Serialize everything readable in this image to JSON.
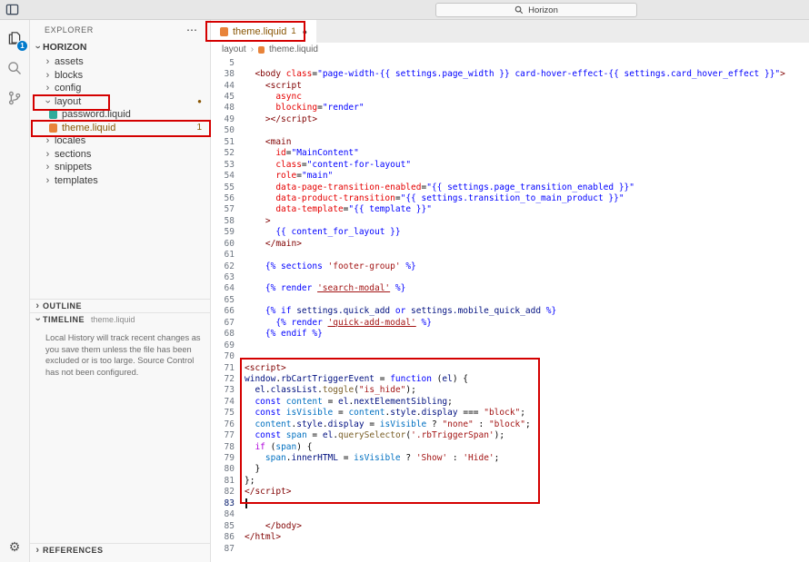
{
  "colors": {
    "annotation_red": "#d40000",
    "badge_blue": "#007acc",
    "git_modified_brown": "#895503",
    "file_icon_orange": "#e8833a",
    "file_icon_teal": "#2fab9b"
  },
  "icons": {
    "chevron": "›",
    "more_actions": "⋯",
    "settings_gear": "⚙",
    "modified_dot": "●"
  },
  "title_bar": {
    "search_text": "Horizon"
  },
  "activity_bar": {
    "badge": "1"
  },
  "sidebar": {
    "header": "EXPLORER",
    "section": "HORIZON",
    "tree": [
      {
        "label": "assets",
        "kind": "folder",
        "expanded": false
      },
      {
        "label": "blocks",
        "kind": "folder",
        "expanded": false
      },
      {
        "label": "config",
        "kind": "folder",
        "expanded": false
      },
      {
        "label": "layout",
        "kind": "folder",
        "expanded": true,
        "dot": true
      },
      {
        "label": "password.liquid",
        "kind": "file",
        "icon": "teal"
      },
      {
        "label": "theme.liquid",
        "kind": "file",
        "icon": "orange",
        "badge": "1",
        "modified": true
      },
      {
        "label": "locales",
        "kind": "folder",
        "expanded": false
      },
      {
        "label": "sections",
        "kind": "folder",
        "expanded": false
      },
      {
        "label": "snippets",
        "kind": "folder",
        "expanded": false
      },
      {
        "label": "templates",
        "kind": "folder",
        "expanded": false
      }
    ],
    "outline": {
      "label": "OUTLINE"
    },
    "timeline": {
      "label": "TIMELINE",
      "file": "theme.liquid",
      "message": "Local History will track recent changes as you save them unless the file has been excluded or is too large. Source Control has not been configured."
    },
    "references": {
      "label": "REFERENCES"
    }
  },
  "editor": {
    "tab": {
      "label": "theme.liquid",
      "badge": "1"
    },
    "breadcrumb": [
      "layout",
      "theme.liquid"
    ],
    "lines": [
      {
        "n": "5",
        "t": []
      },
      {
        "n": "38",
        "t": [
          [
            "tag",
            "  <body "
          ],
          [
            "attr",
            "class"
          ],
          [
            "p",
            "="
          ],
          [
            "str",
            "\"page-width-{{ settings.page_width }} card-hover-effect-{{ settings.card_hover_effect }}\""
          ],
          [
            "tag",
            ">"
          ]
        ]
      },
      {
        "n": "44",
        "t": [
          [
            "tag",
            "    <script"
          ]
        ]
      },
      {
        "n": "45",
        "t": [
          [
            "attr",
            "      async"
          ]
        ]
      },
      {
        "n": "48",
        "t": [
          [
            "attr",
            "      blocking"
          ],
          [
            "p",
            "="
          ],
          [
            "str",
            "\"render\""
          ]
        ]
      },
      {
        "n": "49",
        "t": [
          [
            "tag",
            "    ></script>"
          ]
        ]
      },
      {
        "n": "50",
        "t": []
      },
      {
        "n": "51",
        "t": [
          [
            "tag",
            "    <main"
          ]
        ]
      },
      {
        "n": "52",
        "t": [
          [
            "attr",
            "      id"
          ],
          [
            "p",
            "="
          ],
          [
            "str",
            "\"MainContent\""
          ]
        ]
      },
      {
        "n": "53",
        "t": [
          [
            "attr",
            "      class"
          ],
          [
            "p",
            "="
          ],
          [
            "str",
            "\"content-for-layout\""
          ]
        ]
      },
      {
        "n": "54",
        "t": [
          [
            "attr",
            "      role"
          ],
          [
            "p",
            "="
          ],
          [
            "str",
            "\"main\""
          ]
        ]
      },
      {
        "n": "55",
        "t": [
          [
            "attr",
            "      data-page-transition-enabled"
          ],
          [
            "p",
            "="
          ],
          [
            "str",
            "\"{{ settings.page_transition_enabled }}\""
          ]
        ]
      },
      {
        "n": "56",
        "t": [
          [
            "attr",
            "      data-product-transition"
          ],
          [
            "p",
            "="
          ],
          [
            "str",
            "\"{{ settings.transition_to_main_product }}\""
          ]
        ]
      },
      {
        "n": "57",
        "t": [
          [
            "attr",
            "      data-template"
          ],
          [
            "p",
            "="
          ],
          [
            "str",
            "\"{{ template }}\""
          ]
        ]
      },
      {
        "n": "58",
        "t": [
          [
            "tag",
            "    >"
          ]
        ]
      },
      {
        "n": "59",
        "t": [
          [
            "liq",
            "      {{ content_for_layout }}"
          ]
        ]
      },
      {
        "n": "60",
        "t": [
          [
            "tag",
            "    </main>"
          ]
        ]
      },
      {
        "n": "61",
        "t": []
      },
      {
        "n": "62",
        "t": [
          [
            "liq",
            "    {% sections "
          ],
          [
            "lstr",
            "'footer-group'"
          ],
          [
            "liq",
            " %}"
          ]
        ]
      },
      {
        "n": "63",
        "t": []
      },
      {
        "n": "64",
        "t": [
          [
            "liq",
            "    {% render "
          ],
          [
            "lstru",
            "'search-modal'"
          ],
          [
            "liq",
            " %}"
          ]
        ]
      },
      {
        "n": "65",
        "t": []
      },
      {
        "n": "66",
        "t": [
          [
            "liq",
            "    {% if "
          ],
          [
            "v",
            "settings.quick_add"
          ],
          [
            "liq",
            " or "
          ],
          [
            "v",
            "settings.mobile_quick_add"
          ],
          [
            "liq",
            " %}"
          ]
        ]
      },
      {
        "n": "67",
        "t": [
          [
            "liq",
            "      {% render "
          ],
          [
            "lstru",
            "'quick-add-modal'"
          ],
          [
            "liq",
            " %}"
          ]
        ]
      },
      {
        "n": "68",
        "t": [
          [
            "liq",
            "    {% endif %}"
          ]
        ]
      },
      {
        "n": "69",
        "t": []
      },
      {
        "n": "70",
        "t": []
      },
      {
        "n": "71",
        "t": [
          [
            "tag",
            "<script>"
          ]
        ]
      },
      {
        "n": "72",
        "t": [
          [
            "v",
            "window"
          ],
          [
            "p",
            "."
          ],
          [
            "v",
            "rbCartTriggerEvent"
          ],
          [
            "p",
            " = "
          ],
          [
            "kw",
            "function"
          ],
          [
            "p",
            " ("
          ],
          [
            "v",
            "el"
          ],
          [
            "p",
            ") {"
          ]
        ]
      },
      {
        "n": "73",
        "t": [
          [
            "p",
            "  "
          ],
          [
            "v",
            "el"
          ],
          [
            "p",
            "."
          ],
          [
            "v",
            "classList"
          ],
          [
            "p",
            "."
          ],
          [
            "fn",
            "toggle"
          ],
          [
            "p",
            "("
          ],
          [
            "s",
            "\"is_hide\""
          ],
          [
            "p",
            ");"
          ]
        ]
      },
      {
        "n": "74",
        "t": [
          [
            "p",
            "  "
          ],
          [
            "kw",
            "const"
          ],
          [
            "p",
            " "
          ],
          [
            "c",
            "content"
          ],
          [
            "p",
            " = "
          ],
          [
            "v",
            "el"
          ],
          [
            "p",
            "."
          ],
          [
            "v",
            "nextElementSibling"
          ],
          [
            "p",
            ";"
          ]
        ]
      },
      {
        "n": "75",
        "t": [
          [
            "p",
            "  "
          ],
          [
            "kw",
            "const"
          ],
          [
            "p",
            " "
          ],
          [
            "c",
            "isVisible"
          ],
          [
            "p",
            " = "
          ],
          [
            "c",
            "content"
          ],
          [
            "p",
            "."
          ],
          [
            "v",
            "style"
          ],
          [
            "p",
            "."
          ],
          [
            "v",
            "display"
          ],
          [
            "p",
            " === "
          ],
          [
            "s",
            "\"block\""
          ],
          [
            "p",
            ";"
          ]
        ]
      },
      {
        "n": "76",
        "t": [
          [
            "p",
            "  "
          ],
          [
            "c",
            "content"
          ],
          [
            "p",
            "."
          ],
          [
            "v",
            "style"
          ],
          [
            "p",
            "."
          ],
          [
            "v",
            "display"
          ],
          [
            "p",
            " = "
          ],
          [
            "c",
            "isVisible"
          ],
          [
            "p",
            " ? "
          ],
          [
            "s",
            "\"none\""
          ],
          [
            "p",
            " : "
          ],
          [
            "s",
            "\"block\""
          ],
          [
            "p",
            ";"
          ]
        ]
      },
      {
        "n": "77",
        "t": [
          [
            "p",
            "  "
          ],
          [
            "kw",
            "const"
          ],
          [
            "p",
            " "
          ],
          [
            "c",
            "span"
          ],
          [
            "p",
            " = "
          ],
          [
            "v",
            "el"
          ],
          [
            "p",
            "."
          ],
          [
            "fn",
            "querySelector"
          ],
          [
            "p",
            "("
          ],
          [
            "s",
            "'.rbTriggerSpan'"
          ],
          [
            "p",
            ");"
          ]
        ]
      },
      {
        "n": "78",
        "t": [
          [
            "p",
            "  "
          ],
          [
            "ctrl",
            "if"
          ],
          [
            "p",
            " ("
          ],
          [
            "c",
            "span"
          ],
          [
            "p",
            ") {"
          ]
        ]
      },
      {
        "n": "79",
        "t": [
          [
            "p",
            "    "
          ],
          [
            "c",
            "span"
          ],
          [
            "p",
            "."
          ],
          [
            "v",
            "innerHTML"
          ],
          [
            "p",
            " = "
          ],
          [
            "c",
            "isVisible"
          ],
          [
            "p",
            " ? "
          ],
          [
            "s",
            "'Show'"
          ],
          [
            "p",
            " : "
          ],
          [
            "s",
            "'Hide'"
          ],
          [
            "p",
            ";"
          ]
        ]
      },
      {
        "n": "80",
        "t": [
          [
            "p",
            "  }"
          ]
        ]
      },
      {
        "n": "81",
        "t": [
          [
            "p",
            "};"
          ]
        ]
      },
      {
        "n": "82",
        "t": [
          [
            "tag",
            "</script>"
          ]
        ]
      },
      {
        "n": "83",
        "t": [],
        "cursor": true
      },
      {
        "n": "84",
        "t": []
      },
      {
        "n": "85",
        "t": [
          [
            "tag",
            "    </body>"
          ]
        ]
      },
      {
        "n": "86",
        "t": [
          [
            "tag",
            "</html>"
          ]
        ]
      },
      {
        "n": "87",
        "t": []
      }
    ]
  }
}
